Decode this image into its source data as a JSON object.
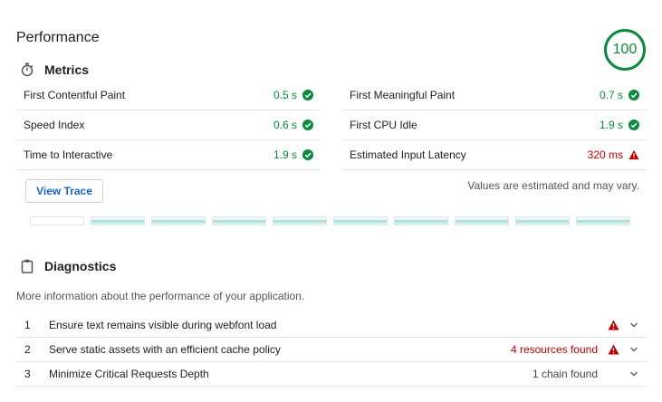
{
  "category": {
    "title": "Performance",
    "score": "100"
  },
  "metrics_group": {
    "title": "Metrics",
    "icon": "stopwatch-icon",
    "items": [
      {
        "name": "First Contentful Paint",
        "value": "0.5 s",
        "status": "pass"
      },
      {
        "name": "First Meaningful Paint",
        "value": "0.7 s",
        "status": "pass"
      },
      {
        "name": "Speed Index",
        "value": "0.6 s",
        "status": "pass"
      },
      {
        "name": "First CPU Idle",
        "value": "1.9 s",
        "status": "pass"
      },
      {
        "name": "Time to Interactive",
        "value": "1.9 s",
        "status": "pass"
      },
      {
        "name": "Estimated Input Latency",
        "value": "320 ms",
        "status": "fail"
      }
    ],
    "view_trace_label": "View Trace",
    "estimate_note": "Values are estimated and may vary."
  },
  "filmstrip": {
    "frames": 10,
    "loaded_from": 1
  },
  "diagnostics_group": {
    "title": "Diagnostics",
    "icon": "clipboard-icon",
    "description": "More information about the performance of your application.",
    "items": [
      {
        "num": "1",
        "title": "Ensure text remains visible during webfont load",
        "display": "",
        "status": "fail"
      },
      {
        "num": "2",
        "title": "Serve static assets with an efficient cache policy",
        "display": "4 resources found",
        "status": "fail"
      },
      {
        "num": "3",
        "title": "Minimize Critical Requests Depth",
        "display": "1 chain found",
        "status": "info"
      }
    ]
  },
  "colors": {
    "pass": "#0a8a3c",
    "fail": "#c00000",
    "link": "#1a66c8"
  }
}
